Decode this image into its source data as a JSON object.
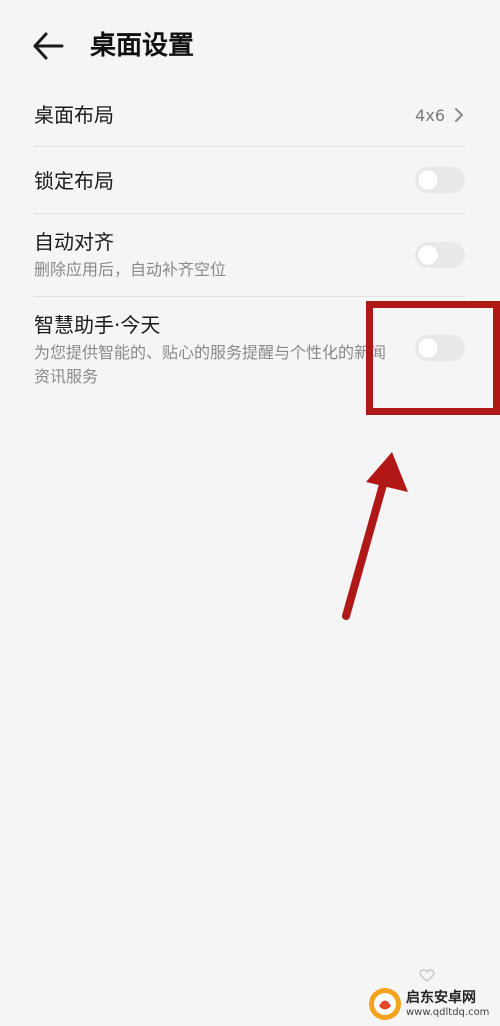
{
  "header": {
    "title": "桌面设置",
    "back_icon": "back-arrow-icon"
  },
  "settings": {
    "layout": {
      "title": "桌面布局",
      "value": "4x6"
    },
    "lock_layout": {
      "title": "锁定布局",
      "enabled": false
    },
    "auto_align": {
      "title": "自动对齐",
      "subtitle": "删除应用后，自动补齐空位",
      "enabled": false
    },
    "smart_assistant": {
      "title": "智慧助手·今天",
      "subtitle": "为您提供智能的、贴心的服务提醒与个性化的新闻资讯服务",
      "enabled": false
    }
  },
  "annotation": {
    "color": "#b01818"
  },
  "watermark": {
    "name": "启东安卓网",
    "url": "www.qdltdq.com"
  },
  "colors": {
    "background": "#f5f5f5",
    "toggle_off": "#e9e9e9",
    "divider": "#e2e2e2"
  }
}
